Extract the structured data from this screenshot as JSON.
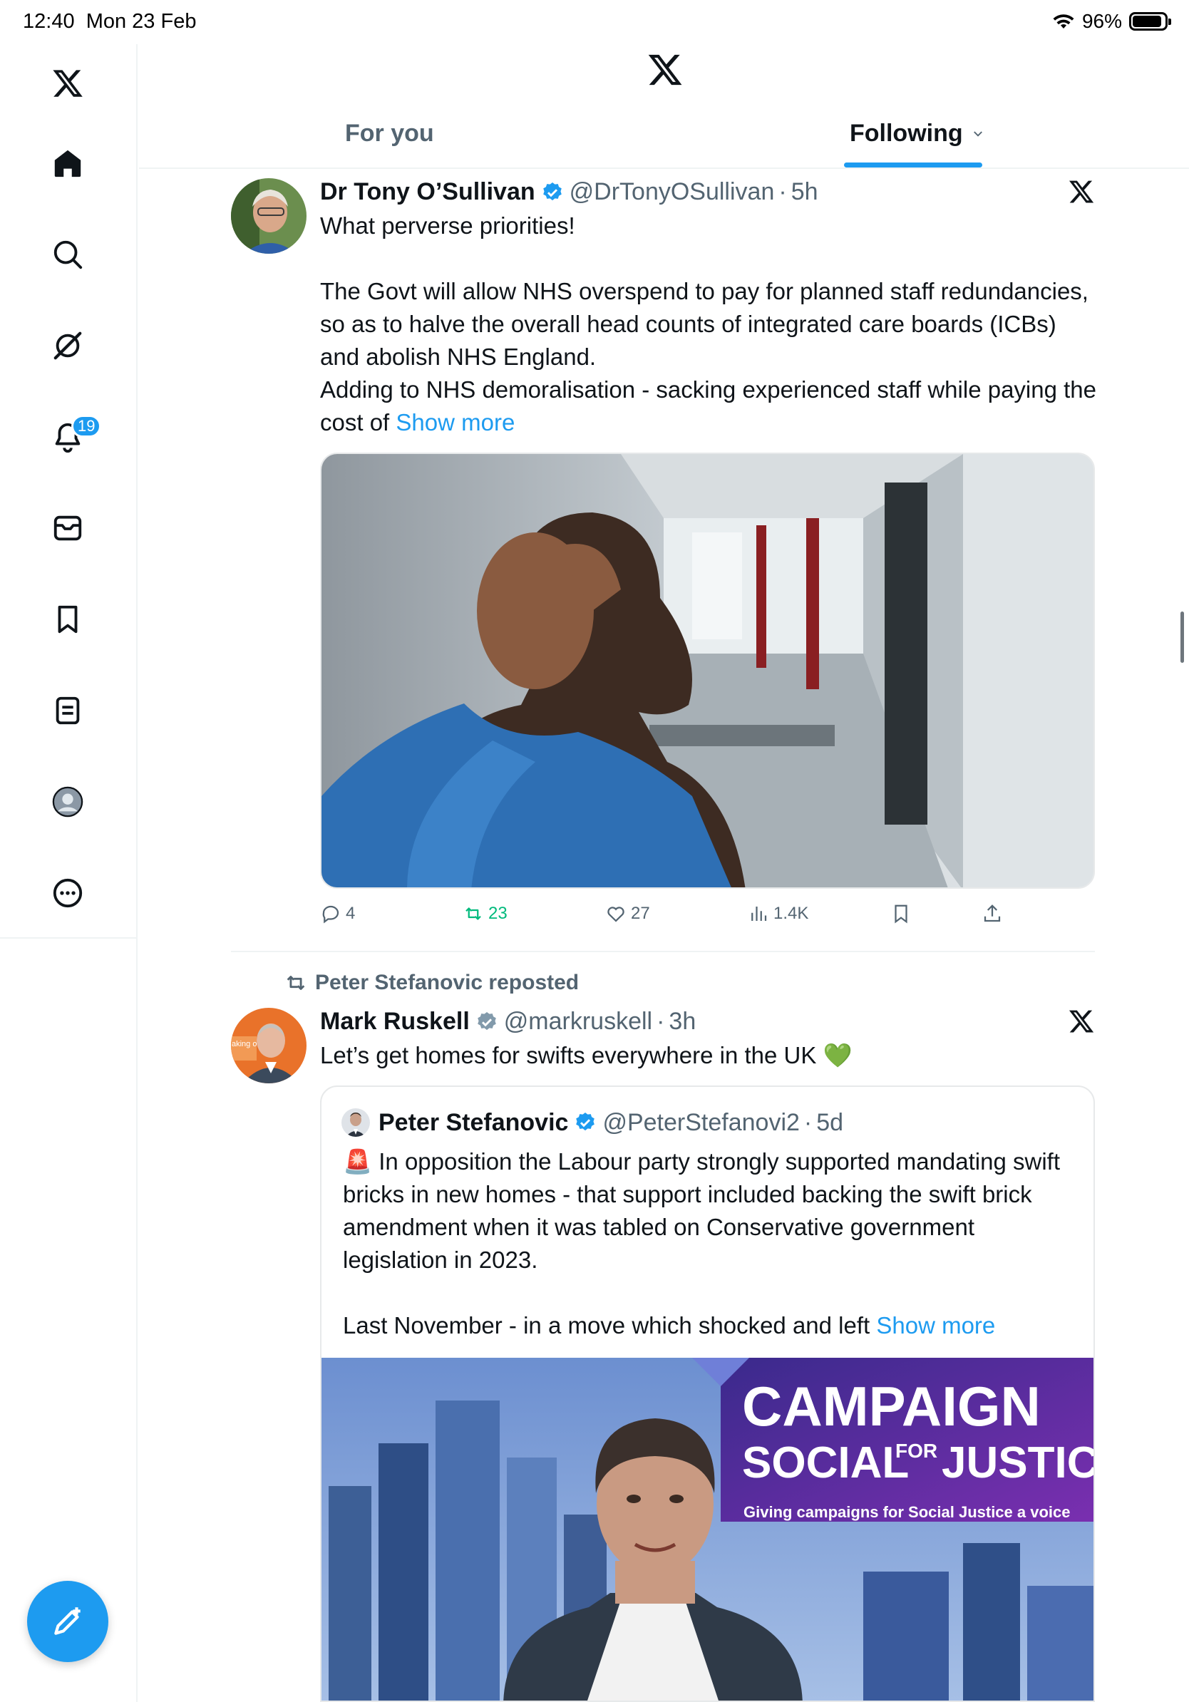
{
  "status_bar": {
    "time": "12:40",
    "date": "Mon 23 Feb",
    "battery": "96%",
    "battery_level": 0.96
  },
  "nav": {
    "items": [
      {
        "name": "home",
        "icon": "home-icon"
      },
      {
        "name": "explore",
        "icon": "search-icon"
      },
      {
        "name": "grok",
        "icon": "grok-icon"
      },
      {
        "name": "notifications",
        "icon": "bell-icon",
        "badge": "19"
      },
      {
        "name": "messages",
        "icon": "mail-icon"
      },
      {
        "name": "bookmarks",
        "icon": "bookmark-icon"
      },
      {
        "name": "lists",
        "icon": "list-icon"
      },
      {
        "name": "profile",
        "icon": "profile-icon"
      },
      {
        "name": "more",
        "icon": "more-icon"
      }
    ],
    "compose_icon": "compose-icon"
  },
  "header": {
    "logo": "x-logo-icon",
    "tabs": [
      {
        "label": "For you"
      },
      {
        "label": "Following"
      }
    ],
    "active_tab": "Following"
  },
  "tweets": [
    {
      "author": "Dr Tony O’Sullivan",
      "handle": "@DrTonyOSullivan",
      "separator": "·",
      "time": "5h",
      "paragraphs": [
        "What perverse priorities!",
        "The Govt will allow NHS overspend to pay for planned staff redundancies, so as to halve the overall head counts of integrated care boards (ICBs) and abolish NHS England.",
        "Adding to NHS demoralisation - sacking experienced staff while paying the cost of"
      ],
      "show_more": "Show more",
      "stats": {
        "replies": "4",
        "reposts": "23",
        "likes": "27",
        "views": "1.4K"
      }
    },
    {
      "reposted_by": "Peter Stefanovic reposted",
      "author": "Mark Ruskell",
      "handle": "@markruskell",
      "separator": "·",
      "time": "3h",
      "text": "Let’s get homes for swifts everywhere in the UK 💚",
      "quote": {
        "author": "Peter Stefanovic",
        "handle": "@PeterStefanovi2",
        "separator": "·",
        "time": "5d",
        "siren": "🚨",
        "paragraph1": "In opposition the Labour party strongly supported mandating swift bricks in new homes - that support included backing the swift brick amendment when it was tabled on Conservative government legislation in 2023.",
        "paragraph2": "Last November - in a move which shocked and left",
        "show_more": "Show more",
        "banner": {
          "line1": "CAMPAIGN",
          "line2a": "SOCIAL",
          "line2b": "FOR",
          "line2c": "JUSTICE",
          "tagline": "Giving campaigns for Social Justice a voice"
        }
      },
      "avatar_banner_text": "aking o rest"
    }
  ],
  "colors": {
    "accent": "#1d9bf0",
    "repost_green": "#00ba7c",
    "secondary_text": "#536471"
  }
}
